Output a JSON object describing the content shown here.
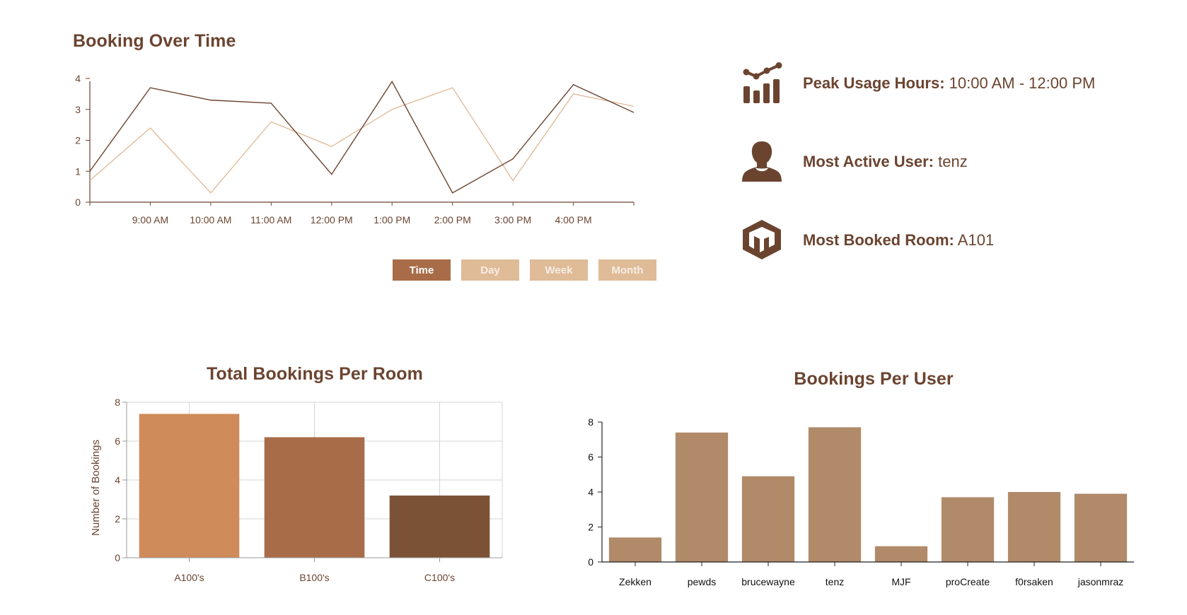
{
  "line_chart": {
    "title": "Booking Over Time",
    "tabs": [
      {
        "label": "Time",
        "active": true
      },
      {
        "label": "Day",
        "active": false
      },
      {
        "label": "Week",
        "active": false
      },
      {
        "label": "Month",
        "active": false
      }
    ]
  },
  "stats": {
    "peak": {
      "label": "Peak Usage Hours:",
      "value": "10:00 AM - 12:00 PM",
      "icon": "bar-chart-trend-icon"
    },
    "user": {
      "label": "Most Active User:",
      "value": "tenz",
      "icon": "user-icon"
    },
    "room": {
      "label": "Most Booked Room:",
      "value": "A101",
      "icon": "room-icon"
    }
  },
  "room_chart": {
    "title": "Total Bookings Per Room",
    "ylabel": "Number of Bookings"
  },
  "user_chart": {
    "title": "Bookings Per User"
  },
  "colors": {
    "dark": "#6b4430",
    "light_line": "#e0b894",
    "room_bars": [
      "#d08b5b",
      "#a86c48",
      "#7c5236"
    ],
    "user_bar": "#b08a69"
  },
  "chart_data": [
    {
      "type": "line",
      "title": "Booking Over Time",
      "categories": [
        "9:00 AM",
        "10:00 AM",
        "11:00 AM",
        "12:00 PM",
        "1:00 PM",
        "2:00 PM",
        "3:00 PM",
        "4:00 PM"
      ],
      "ylim": [
        0,
        4
      ],
      "yticks": [
        0,
        1,
        2,
        3,
        4
      ],
      "grid": false,
      "series": [
        {
          "values": [
            1.0,
            3.7,
            3.3,
            3.2,
            0.9,
            3.9,
            0.3,
            1.4,
            3.8,
            2.9
          ]
        },
        {
          "values": [
            0.7,
            2.4,
            0.3,
            2.6,
            1.8,
            3.0,
            3.7,
            0.7,
            3.5,
            3.1
          ]
        }
      ]
    },
    {
      "type": "bar",
      "title": "Total Bookings Per Room",
      "categories": [
        "A100's",
        "B100's",
        "C100's"
      ],
      "values": [
        7.4,
        6.2,
        3.2
      ],
      "ylabel": "Number of Bookings",
      "ylim": [
        0,
        8
      ],
      "yticks": [
        0,
        2,
        4,
        6,
        8
      ],
      "grid": true
    },
    {
      "type": "bar",
      "title": "Bookings Per User",
      "categories": [
        "Zekken",
        "pewds",
        "brucewayne",
        "tenz",
        "MJF",
        "proCreate",
        "f0rsaken",
        "jasonmraz"
      ],
      "values": [
        1.4,
        7.4,
        4.9,
        7.7,
        0.9,
        3.7,
        4.0,
        3.9
      ],
      "ylim": [
        0,
        8
      ],
      "yticks": [
        0,
        2,
        4,
        6,
        8
      ],
      "grid": false
    }
  ]
}
